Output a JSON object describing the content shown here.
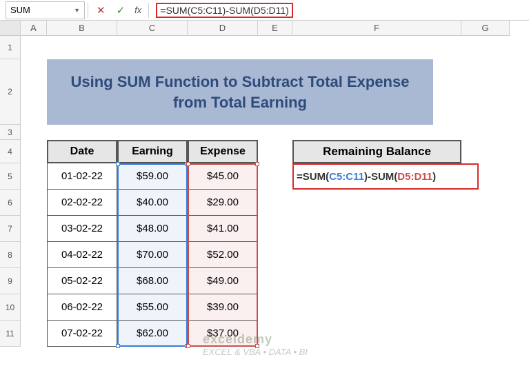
{
  "nameBox": "SUM",
  "formulaBar": "=SUM(C5:C11)-SUM(D5:D11)",
  "columns": [
    "A",
    "B",
    "C",
    "D",
    "E",
    "F",
    "G"
  ],
  "rows": [
    "1",
    "2",
    "3",
    "4",
    "5",
    "6",
    "7",
    "8",
    "9",
    "10",
    "11"
  ],
  "title": "Using SUM Function to Subtract Total Expense from Total Earning",
  "headers": {
    "date": "Date",
    "earning": "Earning",
    "expense": "Expense",
    "balance": "Remaining Balance"
  },
  "data": [
    {
      "date": "01-02-22",
      "earning": "$59.00",
      "expense": "$45.00"
    },
    {
      "date": "02-02-22",
      "earning": "$40.00",
      "expense": "$29.00"
    },
    {
      "date": "03-02-22",
      "earning": "$48.00",
      "expense": "$41.00"
    },
    {
      "date": "04-02-22",
      "earning": "$70.00",
      "expense": "$52.00"
    },
    {
      "date": "05-02-22",
      "earning": "$68.00",
      "expense": "$49.00"
    },
    {
      "date": "06-02-22",
      "earning": "$55.00",
      "expense": "$39.00"
    },
    {
      "date": "07-02-22",
      "earning": "$62.00",
      "expense": "$37.00"
    }
  ],
  "cellFormula": {
    "p1": "=SUM(",
    "r1": "C5:C11",
    "p2": ")-SUM(",
    "r2": "D5:D11",
    "p3": ")"
  },
  "watermark": {
    "brand": "exceldemy",
    "tag": "EXCEL & VBA • DATA • BI"
  }
}
